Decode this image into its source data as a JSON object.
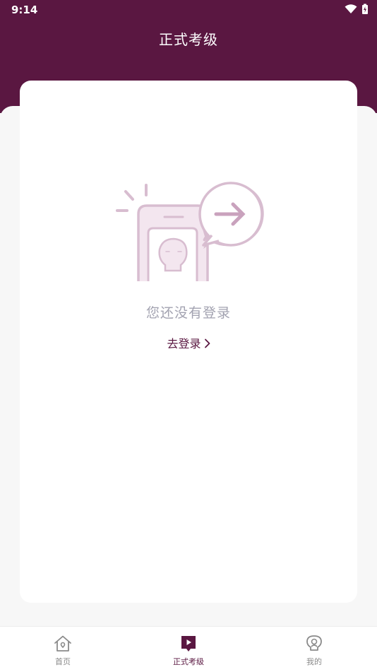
{
  "status": {
    "time": "9:14"
  },
  "header": {
    "title": "正式考级"
  },
  "empty_state": {
    "message": "您还没有登录",
    "action_label": "去登录"
  },
  "tabbar": {
    "items": [
      {
        "label": "首页",
        "icon": "home-icon"
      },
      {
        "label": "正式考级",
        "icon": "video-bookmark-icon",
        "active": true
      },
      {
        "label": "我的",
        "icon": "profile-icon"
      }
    ]
  },
  "colors": {
    "brand": "#5a1741",
    "muted": "#a2a2b0",
    "illustration": "#d8bdd0"
  }
}
